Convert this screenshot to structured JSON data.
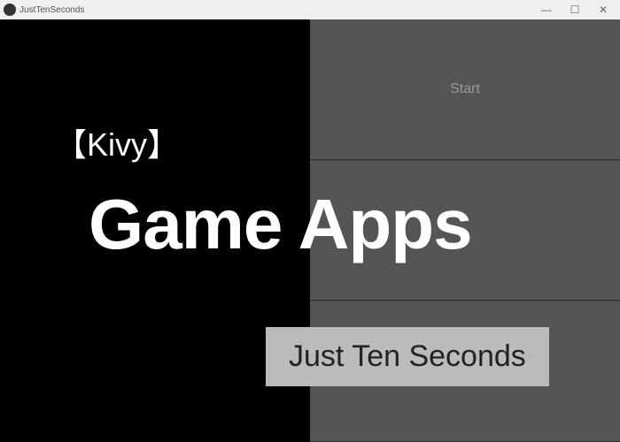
{
  "window": {
    "title": "JustTenSeconds"
  },
  "menu": {
    "items": [
      {
        "label": "Start"
      },
      {
        "label": ""
      },
      {
        "label": ""
      }
    ]
  },
  "overlay": {
    "kivy": "【Kivy】",
    "game_apps": "Game Apps",
    "subtitle": "Just Ten Seconds"
  }
}
